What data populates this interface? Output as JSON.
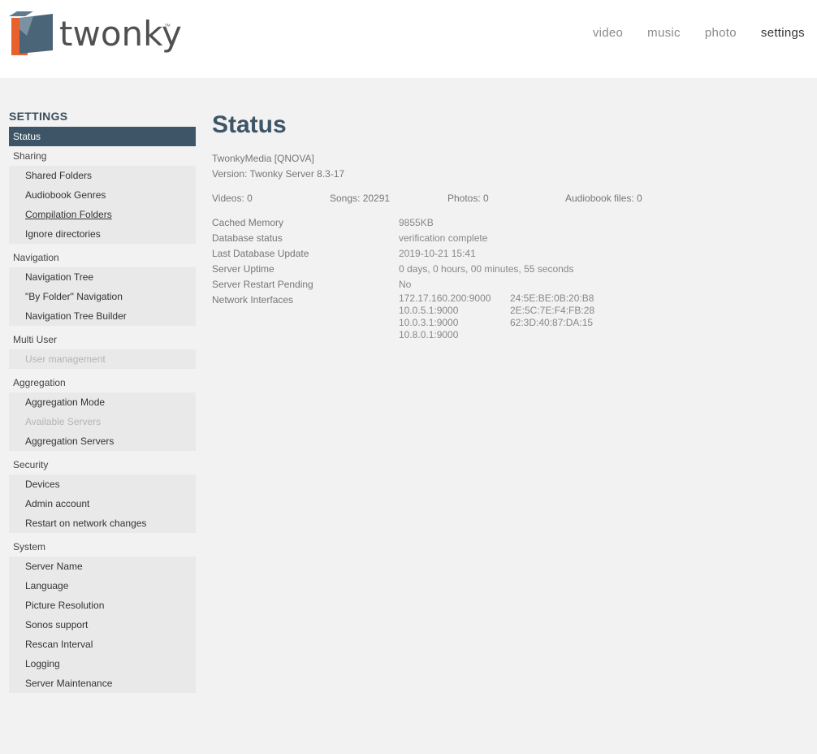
{
  "brand": {
    "name": "twonky",
    "tm": "™"
  },
  "topnav": [
    {
      "label": "video"
    },
    {
      "label": "music"
    },
    {
      "label": "photo"
    },
    {
      "label": "settings"
    }
  ],
  "sidebar": {
    "title": "SETTINGS",
    "status": "Status",
    "sections": [
      {
        "label": "Sharing",
        "items": [
          "Shared Folders",
          "Audiobook Genres",
          "Compilation Folders",
          "Ignore directories"
        ]
      },
      {
        "label": "Navigation",
        "items": [
          "Navigation Tree",
          "\"By Folder\" Navigation",
          "Navigation Tree Builder"
        ]
      },
      {
        "label": "Multi User",
        "items": [
          "User management"
        ]
      },
      {
        "label": "Aggregation",
        "items": [
          "Aggregation Mode",
          "Available Servers",
          "Aggregation Servers"
        ]
      },
      {
        "label": "Security",
        "items": [
          "Devices",
          "Admin account",
          "Restart on network changes"
        ]
      },
      {
        "label": "System",
        "items": [
          "Server Name",
          "Language",
          "Picture Resolution",
          "Sonos support",
          "Rescan Interval",
          "Logging",
          "Server Maintenance"
        ]
      }
    ]
  },
  "main": {
    "title": "Status",
    "server_name": "TwonkyMedia [QNOVA]",
    "version": "Version: Twonky Server 8.3-17",
    "counts": {
      "videos": "Videos: 0",
      "songs": "Songs: 20291",
      "photos": "Photos: 0",
      "audiobooks": "Audiobook files: 0"
    },
    "stats": [
      {
        "label": "Cached Memory",
        "value": "9855KB"
      },
      {
        "label": "Database status",
        "value": "verification complete"
      },
      {
        "label": "Last Database Update",
        "value": "2019-10-21 15:41"
      },
      {
        "label": "Server Uptime",
        "value": "0 days, 0 hours, 00 minutes, 55 seconds"
      },
      {
        "label": "Server Restart Pending",
        "value": "No"
      }
    ],
    "network_label": "Network Interfaces",
    "network": [
      {
        "ip": "172.17.160.200:9000",
        "mac": "24:5E:BE:0B:20:B8"
      },
      {
        "ip": "10.0.5.1:9000",
        "mac": "2E:5C:7E:F4:FB:28"
      },
      {
        "ip": "10.0.3.1:9000",
        "mac": "62:3D:40:87:DA:15"
      },
      {
        "ip": "10.8.0.1:9000",
        "mac": ""
      }
    ]
  }
}
